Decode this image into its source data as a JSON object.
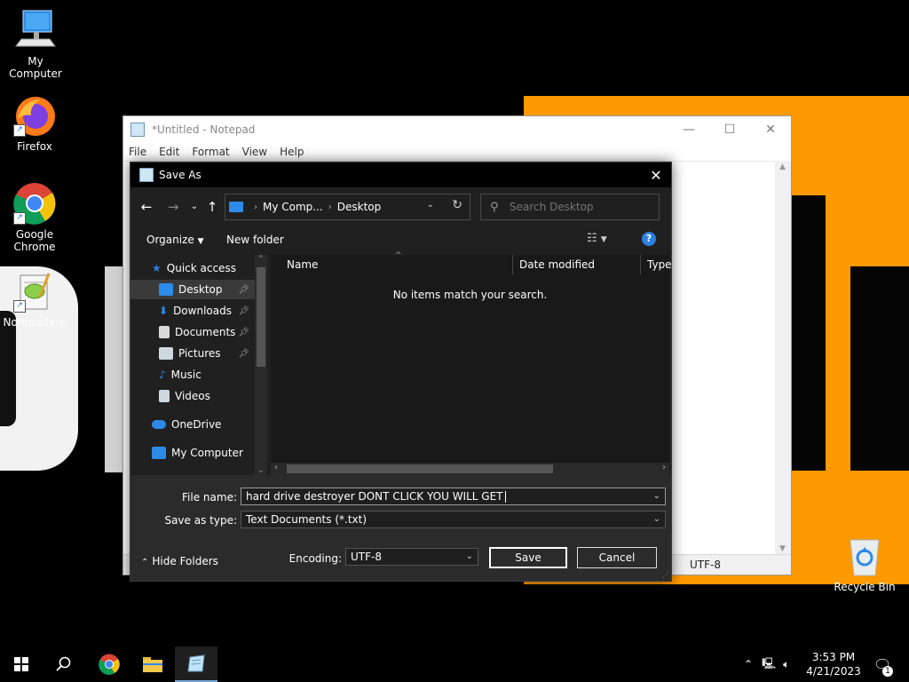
{
  "desktop": {
    "icons": [
      {
        "label": "My Computer"
      },
      {
        "label": "Firefox"
      },
      {
        "label": "Google Chrome"
      },
      {
        "label": "Notepad++"
      },
      {
        "label": "Recycle Bin"
      }
    ]
  },
  "notepad": {
    "title": "*Untitled - Notepad",
    "menu": [
      "File",
      "Edit",
      "Format",
      "View",
      "Help"
    ],
    "status_encoding": "UTF-8"
  },
  "dialog": {
    "title": "Save As",
    "address": {
      "root": "My Comp...",
      "current": "Desktop"
    },
    "search_placeholder": "Search Desktop",
    "toolbar": {
      "organize": "Organize",
      "new_folder": "New folder"
    },
    "nav": [
      {
        "label": "Quick access",
        "icon": "star-icon",
        "color": "#2d7fe0"
      },
      {
        "label": "Desktop",
        "icon": "desktop-folder-icon",
        "color": "#2c8ae8",
        "pinned": true,
        "active": true
      },
      {
        "label": "Downloads",
        "icon": "download-arrow-icon",
        "color": "#2c8ae8",
        "pinned": true
      },
      {
        "label": "Documents",
        "icon": "documents-icon",
        "color": "#d9d9d9",
        "pinned": true
      },
      {
        "label": "Pictures",
        "icon": "pictures-icon",
        "color": "#cfd8e0",
        "pinned": true
      },
      {
        "label": "Music",
        "icon": "music-note-icon",
        "color": "#2c8ae8"
      },
      {
        "label": "Videos",
        "icon": "videos-icon",
        "color": "#cfd8e0"
      },
      {
        "label": "OneDrive",
        "icon": "cloud-icon",
        "color": "#2c8ae8"
      },
      {
        "label": "My Computer",
        "icon": "computer-icon",
        "color": "#2c8ae8"
      }
    ],
    "columns": [
      "Name",
      "Date modified",
      "Type"
    ],
    "empty_message": "No items match your search.",
    "file_name_label": "File name:",
    "file_name_value": "hard drive destroyer DONT CLICK YOU WILL GET",
    "save_type_label": "Save as type:",
    "save_type_value": "Text Documents (*.txt)",
    "hide_folders": "Hide Folders",
    "encoding_label": "Encoding:",
    "encoding_value": "UTF-8",
    "save_button": "Save",
    "cancel_button": "Cancel"
  },
  "taskbar": {
    "time": "3:53 PM",
    "date": "4/21/2023",
    "notification_count": "1"
  },
  "colors": {
    "accent": "#2d7fe0",
    "wallpaper_orange": "#ff9900",
    "dialog_bg": "#202020"
  }
}
